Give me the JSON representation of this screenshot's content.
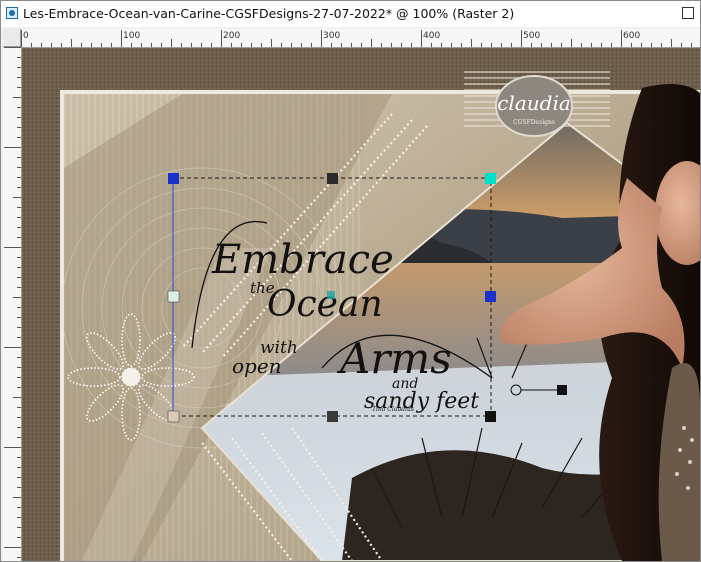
{
  "window": {
    "title": "Les-Embrace-Ocean-van-Carine-CGSFDesigns-27-07-2022* @ 100% (Raster 2)"
  },
  "ruler": {
    "labels": [
      "0",
      "100",
      "200",
      "300",
      "400",
      "500",
      "600"
    ]
  },
  "artwork": {
    "watermark": "claudia",
    "watermark_sub": "CGSFDesigns",
    "text_embrace": "Embrace",
    "text_the": "the",
    "text_ocean": "Ocean",
    "text_with": "with",
    "text_open": "open",
    "text_arms": "Arms",
    "text_and": "and",
    "text_sandy_feet": "sandy feet",
    "text_signature": "Tina Claudius"
  },
  "colors": {
    "frame_outer": "#7a6a56",
    "frame_inner": "#c9bca5",
    "selection_handle": "#1f1f1f",
    "accent_handle": "#00e0c8"
  }
}
